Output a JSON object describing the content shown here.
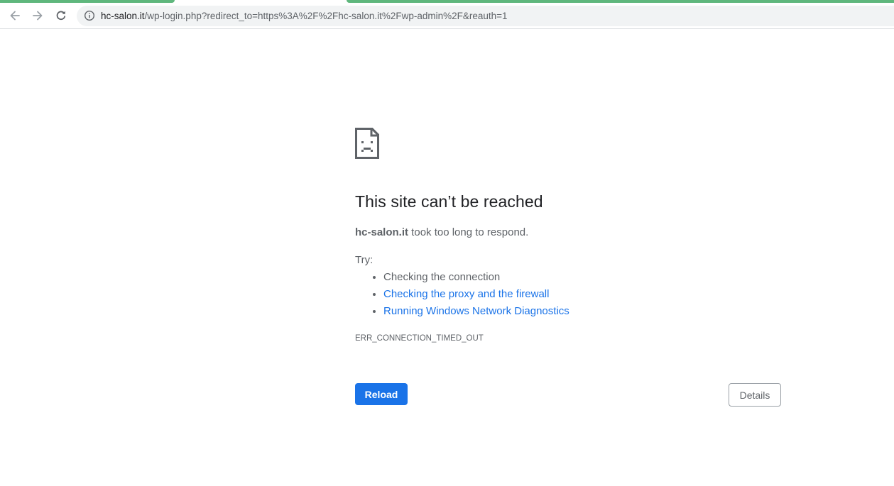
{
  "browser": {
    "url_host": "hc-salon.it",
    "url_path": "/wp-login.php?redirect_to=https%3A%2F%2Fhc-salon.it%2Fwp-admin%2F&reauth=1",
    "icons": {
      "back": "arrow-left-icon",
      "forward": "arrow-right-icon",
      "reload": "reload-icon",
      "site_info": "info-icon"
    },
    "colors": {
      "tab_accent": "#5fb77d",
      "omnibox_bg": "#f1f3f4"
    }
  },
  "error": {
    "icon": "sad-document-icon",
    "title": "This site can’t be reached",
    "host": "hc-salon.it",
    "message": " took too long to respond.",
    "try_label": "Try:",
    "suggestions": [
      {
        "text": "Checking the connection",
        "link": false
      },
      {
        "text": "Checking the proxy and the firewall",
        "link": true
      },
      {
        "text": "Running Windows Network Diagnostics",
        "link": true
      }
    ],
    "code": "ERR_CONNECTION_TIMED_OUT",
    "reload_label": "Reload",
    "details_label": "Details",
    "colors": {
      "primary": "#1a73e8",
      "text": "#5f6368",
      "heading": "#202124"
    }
  }
}
